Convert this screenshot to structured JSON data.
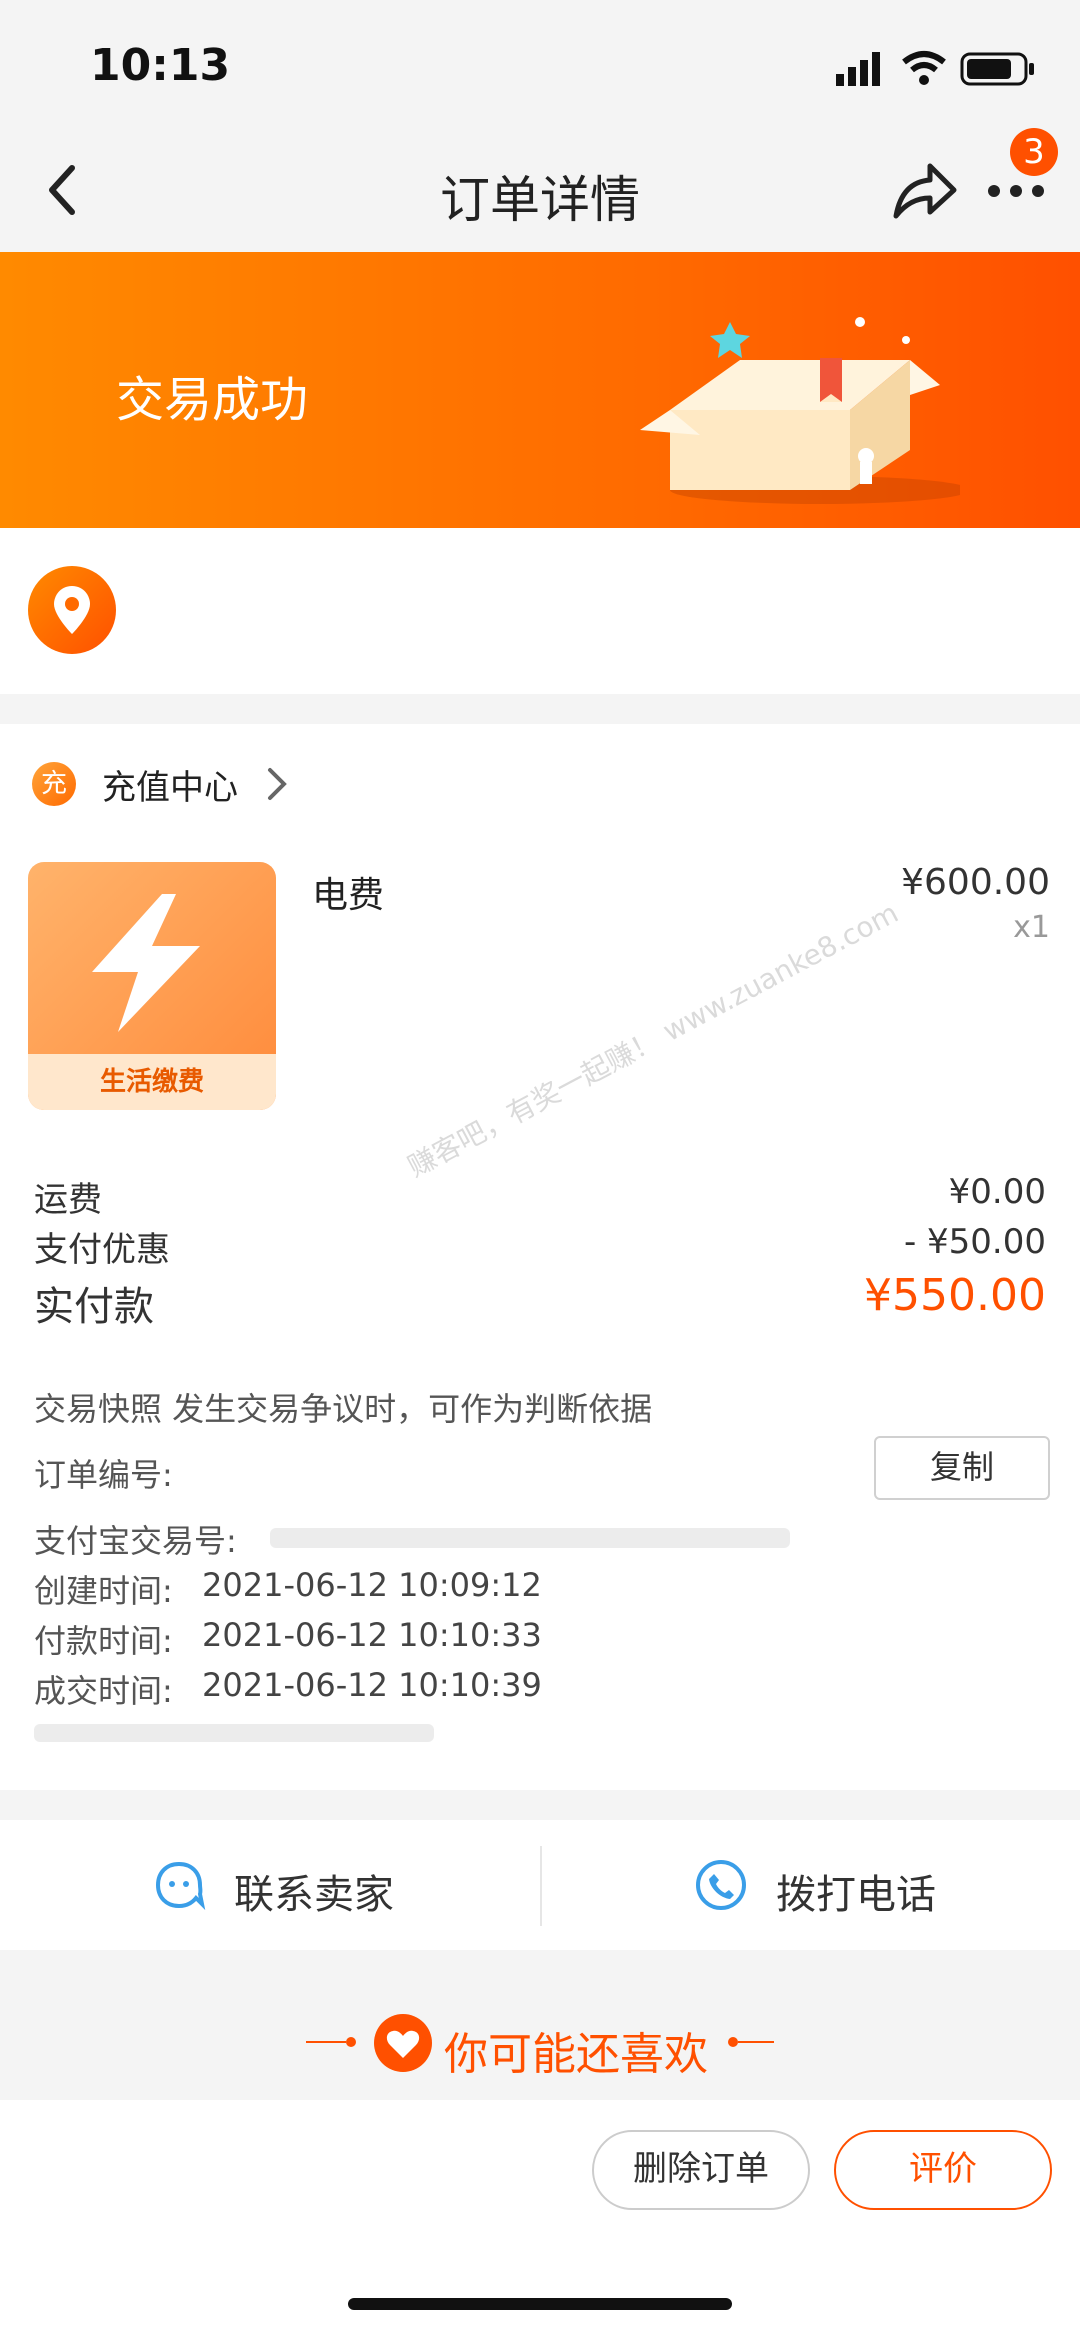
{
  "status": {
    "time": "10:13"
  },
  "nav": {
    "title": "订单详情",
    "badge": "3"
  },
  "banner": {
    "status_text": "交易成功"
  },
  "shop": {
    "icon_text": "充",
    "name": "充值中心"
  },
  "product": {
    "name": "电费",
    "thumb_label": "生活缴费",
    "price": "¥600.00",
    "qty": "x1"
  },
  "fees": [
    {
      "label": "运费",
      "value": "¥0.00"
    },
    {
      "label": "支付优惠",
      "value": "- ¥50.00"
    }
  ],
  "paid": {
    "label": "实付款",
    "value": "¥550.00"
  },
  "details": {
    "snapshot": "交易快照   发生交易争议时，可作为判断依据",
    "order_no_label": "订单编号:",
    "copy_label": "复制",
    "alipay_label": "支付宝交易号:",
    "created_label": "创建时间:",
    "created": "2021-06-12 10:09:12",
    "paid_label": "付款时间:",
    "paid": "2021-06-12 10:10:33",
    "done_label": "成交时间:",
    "done": "2021-06-12 10:10:39"
  },
  "watermark": "赚客吧，有奖一起赚！ www.zuanke8.com",
  "contact": {
    "seller": "联系卖家",
    "phone": "拨打电话"
  },
  "recommend": {
    "title": "你可能还喜欢"
  },
  "actions": {
    "delete": "删除订单",
    "rate": "评价"
  },
  "colors": {
    "accent": "#ff5000",
    "banner_start": "#ff8a00",
    "banner_end": "#ff5000"
  }
}
